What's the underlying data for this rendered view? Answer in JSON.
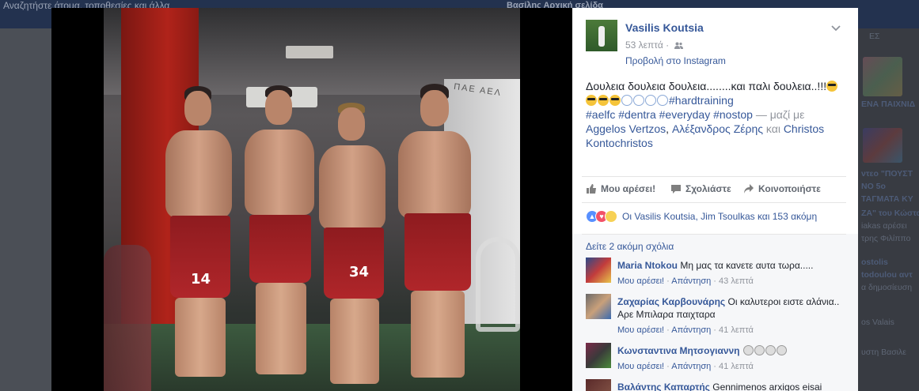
{
  "background": {
    "search_text": "Αναζητήστε άτομα, τοποθεσίες και άλλα",
    "top_right_text": "Βασίλης  Αρχική σελίδα",
    "right_column": [
      "ΕΣ",
      "ΕΝΑ ΠΑΙΧΝΙΔ",
      "ντεο \"ΠΟΥΣΤ",
      "ΝΟ 5ο",
      "ΤΑΓΜΑΤΑ ΚΥ",
      "ΖΑ\" του Κώστα",
      "iakas αρέσει",
      "τρης Φιλίππο",
      "ostolis",
      "todoulou αντ",
      "α δημοσίευση",
      "os Valais",
      "υστη Βασιλε"
    ]
  },
  "post": {
    "author": "Vasilis Koutsia",
    "time": "53 λεπτά ·",
    "instagram_link": "Προβολή στο Instagram",
    "text_plain1": "Δουλεια δουλεια δουλεια........και παλι δουλεια..!!!",
    "hashtags_line1": "#hardtraining",
    "hashtags_line2": "#aelfc #dentra #everyday #nostop",
    "with_text": " — μαζί με ",
    "tagged1": "Aggelos Vertzos",
    "tagged2": "Αλέξανδρος Ζέρης",
    "and": " και ",
    "tagged3": "Christos Kontochristos",
    "photo_wall_text": "ΠΑΕ ΑΕΛ",
    "jersey_numbers": [
      "14",
      "34"
    ]
  },
  "actions": {
    "like": "Μου αρέσει!",
    "comment": "Σχολιάστε",
    "share": "Κοινοποιήστε"
  },
  "reactions": {
    "text": "Οι Vasilis Koutsia, Jim Tsoulkas και 153 ακόμη"
  },
  "comments": {
    "more": "Δείτε 2 ακόμη σχόλια",
    "like_label": "Μου αρέσει!",
    "reply_label": "Απάντηση",
    "items": [
      {
        "name": "Maria Ntokou",
        "text": "Μη μας τα κανετε αυτα τωρα.....",
        "time": "43 λεπτά"
      },
      {
        "name": "Ζαχαρίας Καρβουνάρης",
        "text": "Οι καλυτεροι ειστε αλάνια.. Αρε Μπιλαρα παιχταρα",
        "time": "41 λεπτά"
      },
      {
        "name": "Κωνσταντινα Μητσογιαννη",
        "text": "",
        "time": "41 λεπτά"
      },
      {
        "name": "Βαλάντης Καπαρτής",
        "text": "Gennimenos arxigos eisai",
        "time": ""
      }
    ]
  },
  "colors": {
    "link": "#365899",
    "overlay_bg": "#4b4f56",
    "comments_bg": "#f6f7f9"
  }
}
